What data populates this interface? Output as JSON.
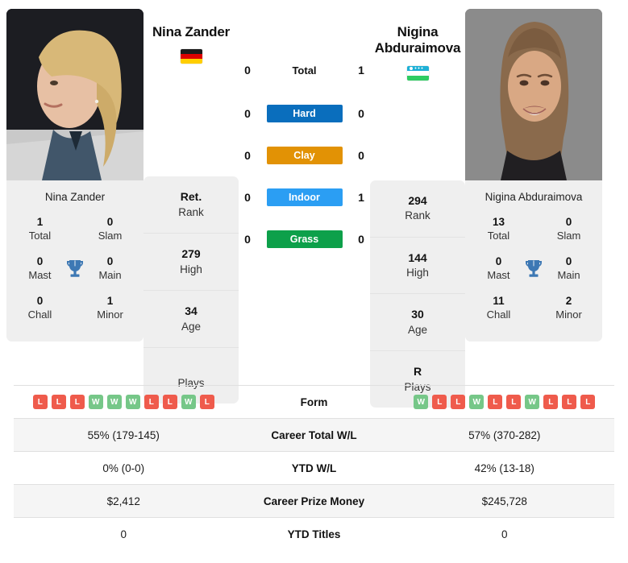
{
  "players": {
    "left": {
      "name": "Nina Zander",
      "photo_caption": "Nina Zander",
      "country": "Germany",
      "flag": "flag-de-icon",
      "titles": {
        "total_value": "1",
        "total_label": "Total",
        "slam_value": "0",
        "slam_label": "Slam",
        "mast_value": "0",
        "mast_label": "Mast",
        "main_value": "0",
        "main_label": "Main",
        "chall_value": "0",
        "chall_label": "Chall",
        "minor_value": "1",
        "minor_label": "Minor"
      },
      "stack": [
        {
          "value": "Ret.",
          "label": "Rank"
        },
        {
          "value": "279",
          "label": "High"
        },
        {
          "value": "34",
          "label": "Age"
        },
        {
          "value": "",
          "label": "Plays"
        }
      ],
      "form": [
        "L",
        "L",
        "L",
        "W",
        "W",
        "W",
        "L",
        "L",
        "W",
        "L"
      ],
      "career_total_wl": "55% (179-145)",
      "ytd_wl": "0% (0-0)",
      "career_prize_money": "$2,412",
      "ytd_titles": "0"
    },
    "right": {
      "name": "Nigina Abduraimova",
      "photo_caption": "Nigina Abduraimova",
      "country": "Uzbekistan",
      "flag": "flag-uz-icon",
      "titles": {
        "total_value": "13",
        "total_label": "Total",
        "slam_value": "0",
        "slam_label": "Slam",
        "mast_value": "0",
        "mast_label": "Mast",
        "main_value": "0",
        "main_label": "Main",
        "chall_value": "11",
        "chall_label": "Chall",
        "minor_value": "2",
        "minor_label": "Minor"
      },
      "stack": [
        {
          "value": "294",
          "label": "Rank"
        },
        {
          "value": "144",
          "label": "High"
        },
        {
          "value": "30",
          "label": "Age"
        },
        {
          "value": "R",
          "label": "Plays"
        }
      ],
      "form": [
        "W",
        "L",
        "L",
        "W",
        "L",
        "L",
        "W",
        "L",
        "L",
        "L"
      ],
      "career_total_wl": "57% (370-282)",
      "ytd_wl": "42% (13-18)",
      "career_prize_money": "$245,728",
      "ytd_titles": "0"
    }
  },
  "head_to_head": {
    "total": {
      "label": "Total",
      "left": "0",
      "right": "1"
    },
    "surfaces": [
      {
        "label": "Hard",
        "left": "0",
        "right": "0",
        "color": "#0a6ebd"
      },
      {
        "label": "Clay",
        "left": "0",
        "right": "0",
        "color": "#e29205"
      },
      {
        "label": "Indoor",
        "left": "0",
        "right": "1",
        "color": "#2b9ef3"
      },
      {
        "label": "Grass",
        "left": "0",
        "right": "0",
        "color": "#0da04a"
      }
    ]
  },
  "table": {
    "rows": [
      {
        "label": "Form"
      },
      {
        "label": "Career Total W/L"
      },
      {
        "label": "YTD W/L"
      },
      {
        "label": "Career Prize Money"
      },
      {
        "label": "YTD Titles"
      }
    ]
  },
  "colors": {
    "win": "#76c788",
    "loss": "#ef5b4c",
    "hard": "#0a6ebd",
    "clay": "#e29205",
    "indoor": "#2b9ef3",
    "grass": "#0da04a",
    "trophy": "#3d78b4",
    "panel": "#efefef"
  }
}
